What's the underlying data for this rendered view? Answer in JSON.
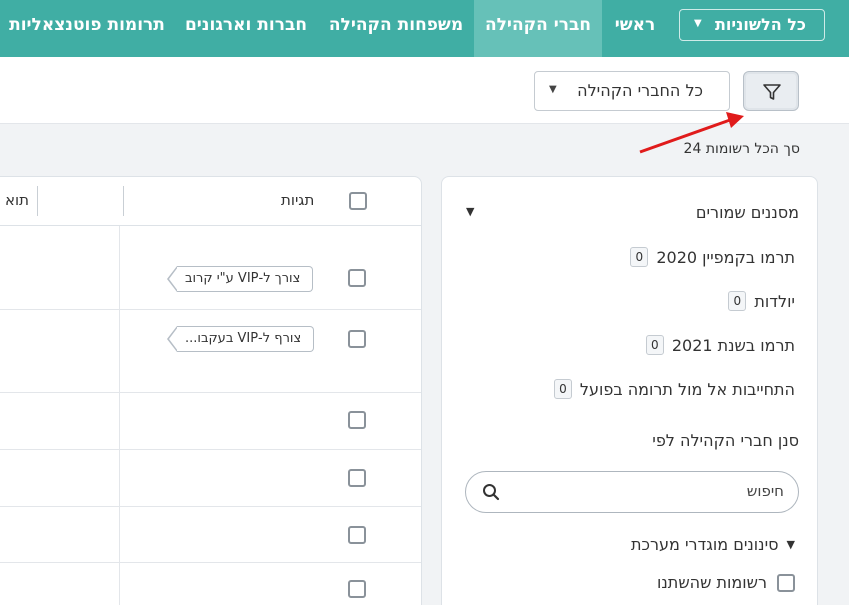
{
  "nav": {
    "language_select": "כל הלשוניות",
    "items": [
      "ראשי",
      "חברי הקהילה",
      "משפחות הקהילה",
      "חברות וארגונים",
      "תרומות פוטנצאליות"
    ],
    "active": "חברי הקהילה"
  },
  "toolbar": {
    "members_select": "כל החברי הקהילה"
  },
  "total_label": "סך הכל רשומות 24",
  "panel": {
    "saved_filters_title": "מסננים שמורים",
    "saved_filters": [
      {
        "label": "תרמו בקמפיין 2020",
        "count": "0"
      },
      {
        "label": "יולדות",
        "count": "0"
      },
      {
        "label": "תרמו בשנת 2021",
        "count": "0"
      },
      {
        "label": "התחייבות אל מול תרומה בפועל",
        "count": "0"
      }
    ],
    "filter_by_title": "סנן חברי הקהילה לפי",
    "search_placeholder": "חיפוש",
    "system_filters_title": "סינונים מוגדרי מערכת",
    "changed_records_label": "רשומות שהשתנו"
  },
  "table": {
    "headers": {
      "tags": "תגיות",
      "next": "תוא"
    },
    "rows": [
      {
        "tag": "צורך ל-VIP ע\"י קרוב"
      },
      {
        "tag": "צורף ל-VIP בעקבו..."
      },
      {
        "tag": ""
      },
      {
        "tag": ""
      },
      {
        "tag": ""
      },
      {
        "tag": ""
      }
    ]
  },
  "colors": {
    "topbar": "#40aea4",
    "topbar_active": "#66c1b8",
    "annotation_arrow": "#e01b1b"
  }
}
